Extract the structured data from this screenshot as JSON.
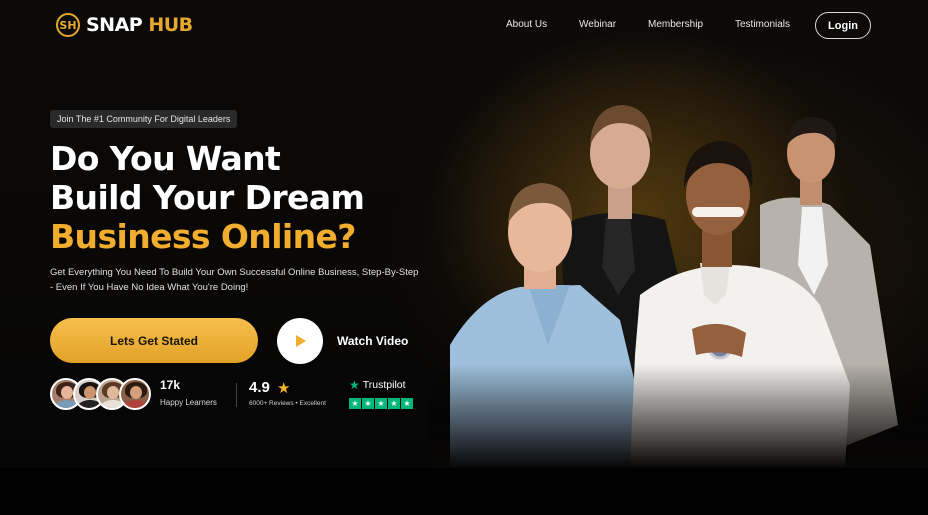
{
  "brand": {
    "mark": "SH",
    "name_white": "SNAP ",
    "name_gold": "HUB"
  },
  "nav": {
    "items": [
      "About Us",
      "Webinar",
      "Membership",
      "Testimonials"
    ],
    "login_label": "Login"
  },
  "hero": {
    "badge": "Join The #1 Community For Digital Leaders",
    "headline": [
      "Do You Want",
      "Build Your Dream"
    ],
    "headline_highlight": "Business Online?",
    "subtitle": "Get Everything You Need To Build Your Own Successful Online Business, Step-By-Step - Even If You Have No Idea What You're Doing!",
    "cta_label": "Lets Get Stated",
    "watch_label": "Watch Video"
  },
  "stats": {
    "learners_count": "17k",
    "learners_label": "Happy Learners",
    "rating": "4.9",
    "reviews_text": "6000+ Reviews  •  Excellent",
    "trustpilot_label": "Trustpilot",
    "trustpilot_stars": 5
  },
  "colors": {
    "accent": "#f0ad2e",
    "trustpilot": "#00b67a"
  },
  "icons": [
    "logo-mark-icon",
    "play-icon",
    "star-icon",
    "trustpilot-star-icon"
  ]
}
